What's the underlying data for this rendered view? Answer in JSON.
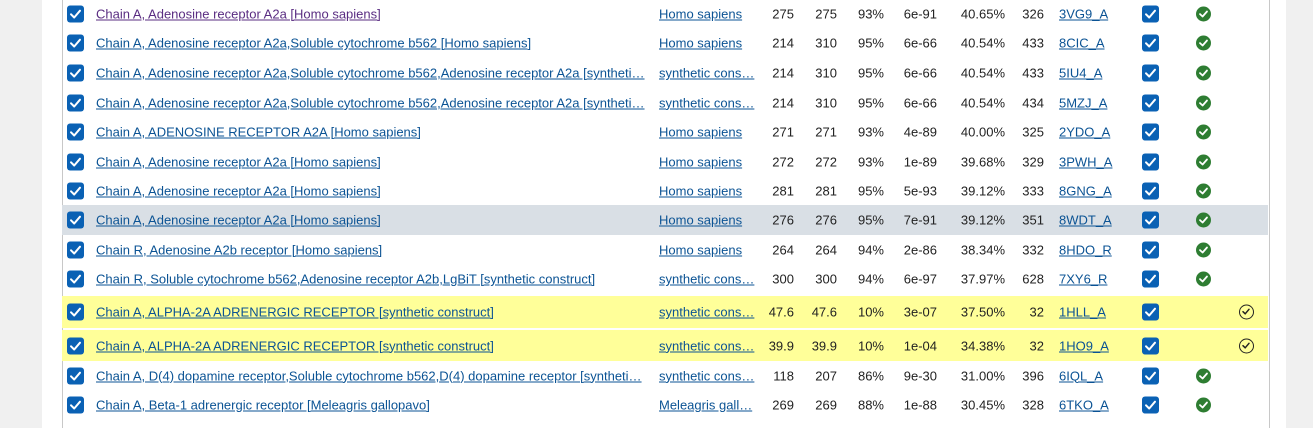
{
  "rows": [
    {
      "description": "Chain A, Adenosine receptor A2a [Homo sapiens]",
      "scientific_name": "Homo sapiens",
      "max_score": "275",
      "total_score": "275",
      "query_cover": "93%",
      "e_value": "6e-91",
      "per_ident": "40.65%",
      "acc_len": "326",
      "accession": "3VG9_A",
      "visited": true,
      "highlight": "none",
      "status": "green-check"
    },
    {
      "description": "Chain A, Adenosine receptor A2a,Soluble cytochrome b562 [Homo sapiens]",
      "scientific_name": "Homo sapiens",
      "max_score": "214",
      "total_score": "310",
      "query_cover": "95%",
      "e_value": "6e-66",
      "per_ident": "40.54%",
      "acc_len": "433",
      "accession": "8CIC_A",
      "visited": false,
      "highlight": "none",
      "status": "green-check"
    },
    {
      "description": "Chain A, Adenosine receptor A2a,Soluble cytochrome b562,Adenosine receptor A2a [syntheti…",
      "scientific_name": "synthetic cons…",
      "max_score": "214",
      "total_score": "310",
      "query_cover": "95%",
      "e_value": "6e-66",
      "per_ident": "40.54%",
      "acc_len": "433",
      "accession": "5IU4_A",
      "visited": false,
      "highlight": "none",
      "status": "green-check"
    },
    {
      "description": "Chain A, Adenosine receptor A2a,Soluble cytochrome b562,Adenosine receptor A2a [syntheti…",
      "scientific_name": "synthetic cons…",
      "max_score": "214",
      "total_score": "310",
      "query_cover": "95%",
      "e_value": "6e-66",
      "per_ident": "40.54%",
      "acc_len": "434",
      "accession": "5MZJ_A",
      "visited": false,
      "highlight": "none",
      "status": "green-check"
    },
    {
      "description": "Chain A, ADENOSINE RECEPTOR A2A [Homo sapiens]",
      "scientific_name": "Homo sapiens",
      "max_score": "271",
      "total_score": "271",
      "query_cover": "93%",
      "e_value": "4e-89",
      "per_ident": "40.00%",
      "acc_len": "325",
      "accession": "2YDO_A",
      "visited": false,
      "highlight": "none",
      "status": "green-check"
    },
    {
      "description": "Chain A, Adenosine receptor A2a [Homo sapiens]",
      "scientific_name": "Homo sapiens",
      "max_score": "272",
      "total_score": "272",
      "query_cover": "93%",
      "e_value": "1e-89",
      "per_ident": "39.68%",
      "acc_len": "329",
      "accession": "3PWH_A",
      "visited": false,
      "highlight": "none",
      "status": "green-check"
    },
    {
      "description": "Chain A, Adenosine receptor A2a [Homo sapiens]",
      "scientific_name": "Homo sapiens",
      "max_score": "281",
      "total_score": "281",
      "query_cover": "95%",
      "e_value": "5e-93",
      "per_ident": "39.12%",
      "acc_len": "333",
      "accession": "8GNG_A",
      "visited": false,
      "highlight": "none",
      "status": "green-check"
    },
    {
      "description": "Chain A, Adenosine receptor A2a [Homo sapiens]",
      "scientific_name": "Homo sapiens",
      "max_score": "276",
      "total_score": "276",
      "query_cover": "95%",
      "e_value": "7e-91",
      "per_ident": "39.12%",
      "acc_len": "351",
      "accession": "8WDT_A",
      "visited": false,
      "highlight": "hover",
      "status": "green-check"
    },
    {
      "description": "Chain R, Adenosine A2b receptor [Homo sapiens]",
      "scientific_name": "Homo sapiens",
      "max_score": "264",
      "total_score": "264",
      "query_cover": "94%",
      "e_value": "2e-86",
      "per_ident": "38.34%",
      "acc_len": "332",
      "accession": "8HDO_R",
      "visited": false,
      "highlight": "none",
      "status": "green-check"
    },
    {
      "description": "Chain R, Soluble cytochrome b562,Adenosine receptor A2b,LgBiT [synthetic construct]",
      "scientific_name": "synthetic cons…",
      "max_score": "300",
      "total_score": "300",
      "query_cover": "94%",
      "e_value": "6e-97",
      "per_ident": "37.97%",
      "acc_len": "628",
      "accession": "7XY6_R",
      "visited": false,
      "highlight": "none",
      "status": "green-check"
    },
    {
      "description": "Chain A, ALPHA-2A ADRENERGIC RECEPTOR [synthetic construct]",
      "scientific_name": "synthetic cons…",
      "max_score": "47.6",
      "total_score": "47.6",
      "query_cover": "10%",
      "e_value": "3e-07",
      "per_ident": "37.50%",
      "acc_len": "32",
      "accession": "1HLL_A",
      "visited": false,
      "highlight": "yellow",
      "status": "yellow-check"
    },
    {
      "description": "Chain A, ALPHA-2A ADRENERGIC RECEPTOR [synthetic construct]",
      "scientific_name": "synthetic cons…",
      "max_score": "39.9",
      "total_score": "39.9",
      "query_cover": "10%",
      "e_value": "1e-04",
      "per_ident": "34.38%",
      "acc_len": "32",
      "accession": "1HO9_A",
      "visited": false,
      "highlight": "yellow",
      "status": "yellow-check"
    },
    {
      "description": "Chain A, D(4) dopamine receptor,Soluble cytochrome b562,D(4) dopamine receptor [syntheti…",
      "scientific_name": "synthetic cons…",
      "max_score": "118",
      "total_score": "207",
      "query_cover": "86%",
      "e_value": "9e-30",
      "per_ident": "31.00%",
      "acc_len": "396",
      "accession": "6IQL_A",
      "visited": false,
      "highlight": "none",
      "status": "green-check"
    },
    {
      "description": "Chain A, Beta-1 adrenergic receptor [Meleagris gallopavo]",
      "scientific_name": "Meleagris gall…",
      "max_score": "269",
      "total_score": "269",
      "query_cover": "88%",
      "e_value": "1e-88",
      "per_ident": "30.45%",
      "acc_len": "328",
      "accession": "6TKO_A",
      "visited": false,
      "highlight": "none",
      "status": "green-check"
    }
  ]
}
